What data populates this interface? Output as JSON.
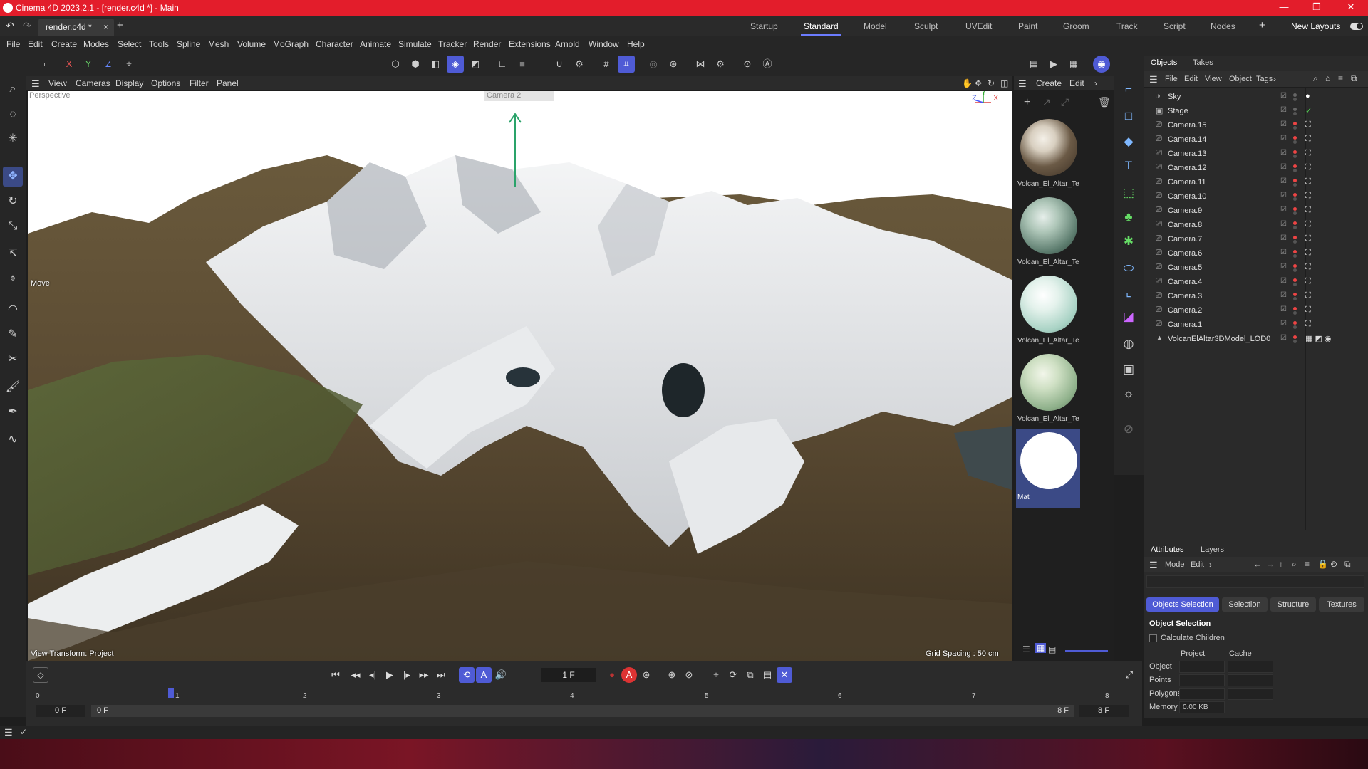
{
  "window": {
    "title": "Cinema 4D 2023.2.1 - [render.c4d *] - Main",
    "controls": [
      "—",
      "❐",
      "✕"
    ]
  },
  "tabs": {
    "doc_tab": "render.c4d *",
    "close": "×",
    "add": "+"
  },
  "layouts": {
    "items": [
      "Startup",
      "Standard",
      "Model",
      "Sculpt",
      "UVEdit",
      "Paint",
      "Groom",
      "Track",
      "Script",
      "Nodes"
    ],
    "active": "Standard",
    "add": "+",
    "new_layouts": "New Layouts"
  },
  "menu": [
    "File",
    "Edit",
    "Create",
    "Modes",
    "Select",
    "Tools",
    "Spline",
    "Mesh",
    "Volume",
    "MoGraph",
    "Character",
    "Animate",
    "Simulate",
    "Tracker",
    "Render",
    "Extensions",
    "Arnold",
    "Window",
    "Help"
  ],
  "toolbar": {
    "axis_x": "X",
    "axis_y": "Y",
    "axis_z": "Z"
  },
  "viewport": {
    "menu": [
      "View",
      "Cameras",
      "Display",
      "Options",
      "Filter",
      "Panel"
    ],
    "camera_label": "Perspective",
    "camera_dropdown": "Camera 2",
    "tool_hint": "Move",
    "view_transform": "View Transform: Project",
    "grid_spacing": "Grid Spacing : 50 cm",
    "axis_labels": [
      "Z",
      "Y",
      "X"
    ]
  },
  "materials": {
    "menu": [
      "Create",
      "Edit"
    ],
    "items": [
      {
        "label": "Volcan_El_Altar_Te",
        "color": "#6b5a46"
      },
      {
        "label": "Volcan_El_Altar_Te",
        "color": "#7a9a8c"
      },
      {
        "label": "Volcan_El_Altar_Te",
        "color": "#b6d6cc"
      },
      {
        "label": "Volcan_El_Altar_Te",
        "color": "#a6bf9a"
      },
      {
        "label": "Mat",
        "color": "#ffffff"
      }
    ]
  },
  "objects_panel": {
    "tabs": [
      "Objects",
      "Takes"
    ],
    "menu": [
      "File",
      "Edit",
      "View",
      "Object",
      "Tags"
    ],
    "items": [
      {
        "name": "Sky",
        "icon": "sky-icon"
      },
      {
        "name": "Stage",
        "icon": "stage-icon"
      },
      {
        "name": "Camera.15",
        "icon": "camera-icon"
      },
      {
        "name": "Camera.14",
        "icon": "camera-icon"
      },
      {
        "name": "Camera.13",
        "icon": "camera-icon"
      },
      {
        "name": "Camera.12",
        "icon": "camera-icon"
      },
      {
        "name": "Camera.11",
        "icon": "camera-icon"
      },
      {
        "name": "Camera.10",
        "icon": "camera-icon"
      },
      {
        "name": "Camera.9",
        "icon": "camera-icon"
      },
      {
        "name": "Camera.8",
        "icon": "camera-icon"
      },
      {
        "name": "Camera.7",
        "icon": "camera-icon"
      },
      {
        "name": "Camera.6",
        "icon": "camera-icon"
      },
      {
        "name": "Camera.5",
        "icon": "camera-icon"
      },
      {
        "name": "Camera.4",
        "icon": "camera-icon"
      },
      {
        "name": "Camera.3",
        "icon": "camera-icon"
      },
      {
        "name": "Camera.2",
        "icon": "camera-icon"
      },
      {
        "name": "Camera.1",
        "icon": "camera-icon"
      },
      {
        "name": "VolcanElAltar3DModel_LOD0",
        "icon": "mesh-icon"
      }
    ]
  },
  "attributes_panel": {
    "tabs": [
      "Attributes",
      "Layers"
    ],
    "menu": [
      "Mode",
      "Edit"
    ],
    "pills": [
      "Objects Selection",
      "Selection",
      "Structure",
      "Textures"
    ],
    "active_pill": "Objects Selection",
    "section_title": "Object Selection",
    "checkbox": "Calculate Children",
    "columns": [
      "Project",
      "Cache"
    ],
    "rows": [
      "Object",
      "Points",
      "Polygons",
      "Memory"
    ],
    "memory_value": "0.00 KB"
  },
  "timeline": {
    "current_frame": "1 F",
    "start_frame": "0 F",
    "start_frame2": "0 F",
    "end_frame": "8 F",
    "end_frame2": "8 F",
    "ticks": [
      "0",
      "1",
      "2",
      "3",
      "4",
      "5",
      "6",
      "7",
      "8"
    ]
  },
  "colors": {
    "title_bar": "#e31d2b",
    "accent": "#4f5bd5"
  }
}
